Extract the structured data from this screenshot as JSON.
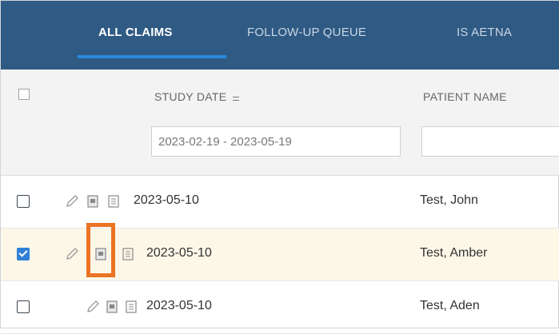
{
  "tabs": [
    {
      "label": "ALL CLAIMS",
      "active": true
    },
    {
      "label": "FOLLOW-UP QUEUE",
      "active": false
    },
    {
      "label": "IS AETNA",
      "active": false
    }
  ],
  "columns": {
    "study_date": "STUDY DATE",
    "patient_name": "PATIENT NAME"
  },
  "filters": {
    "study_date_value": "2023-02-19 - 2023-05-19",
    "patient_name_value": ""
  },
  "rows": [
    {
      "checked": false,
      "study_date": "2023-05-10",
      "patient_name": "Test, John"
    },
    {
      "checked": true,
      "study_date": "2023-05-10",
      "patient_name": "Test, Amber"
    },
    {
      "checked": false,
      "study_date": "2023-05-10",
      "patient_name": "Test, Aden"
    }
  ],
  "colors": {
    "tabbar_bg": "#2f5a84",
    "tab_underline": "#2d89d8",
    "selected_row_bg": "#fdf7e8",
    "checkbox_checked": "#2f80d6",
    "highlight": "#ea7324"
  },
  "icons": [
    "edit-pencil-icon",
    "claim-form-icon",
    "document-list-icon"
  ]
}
